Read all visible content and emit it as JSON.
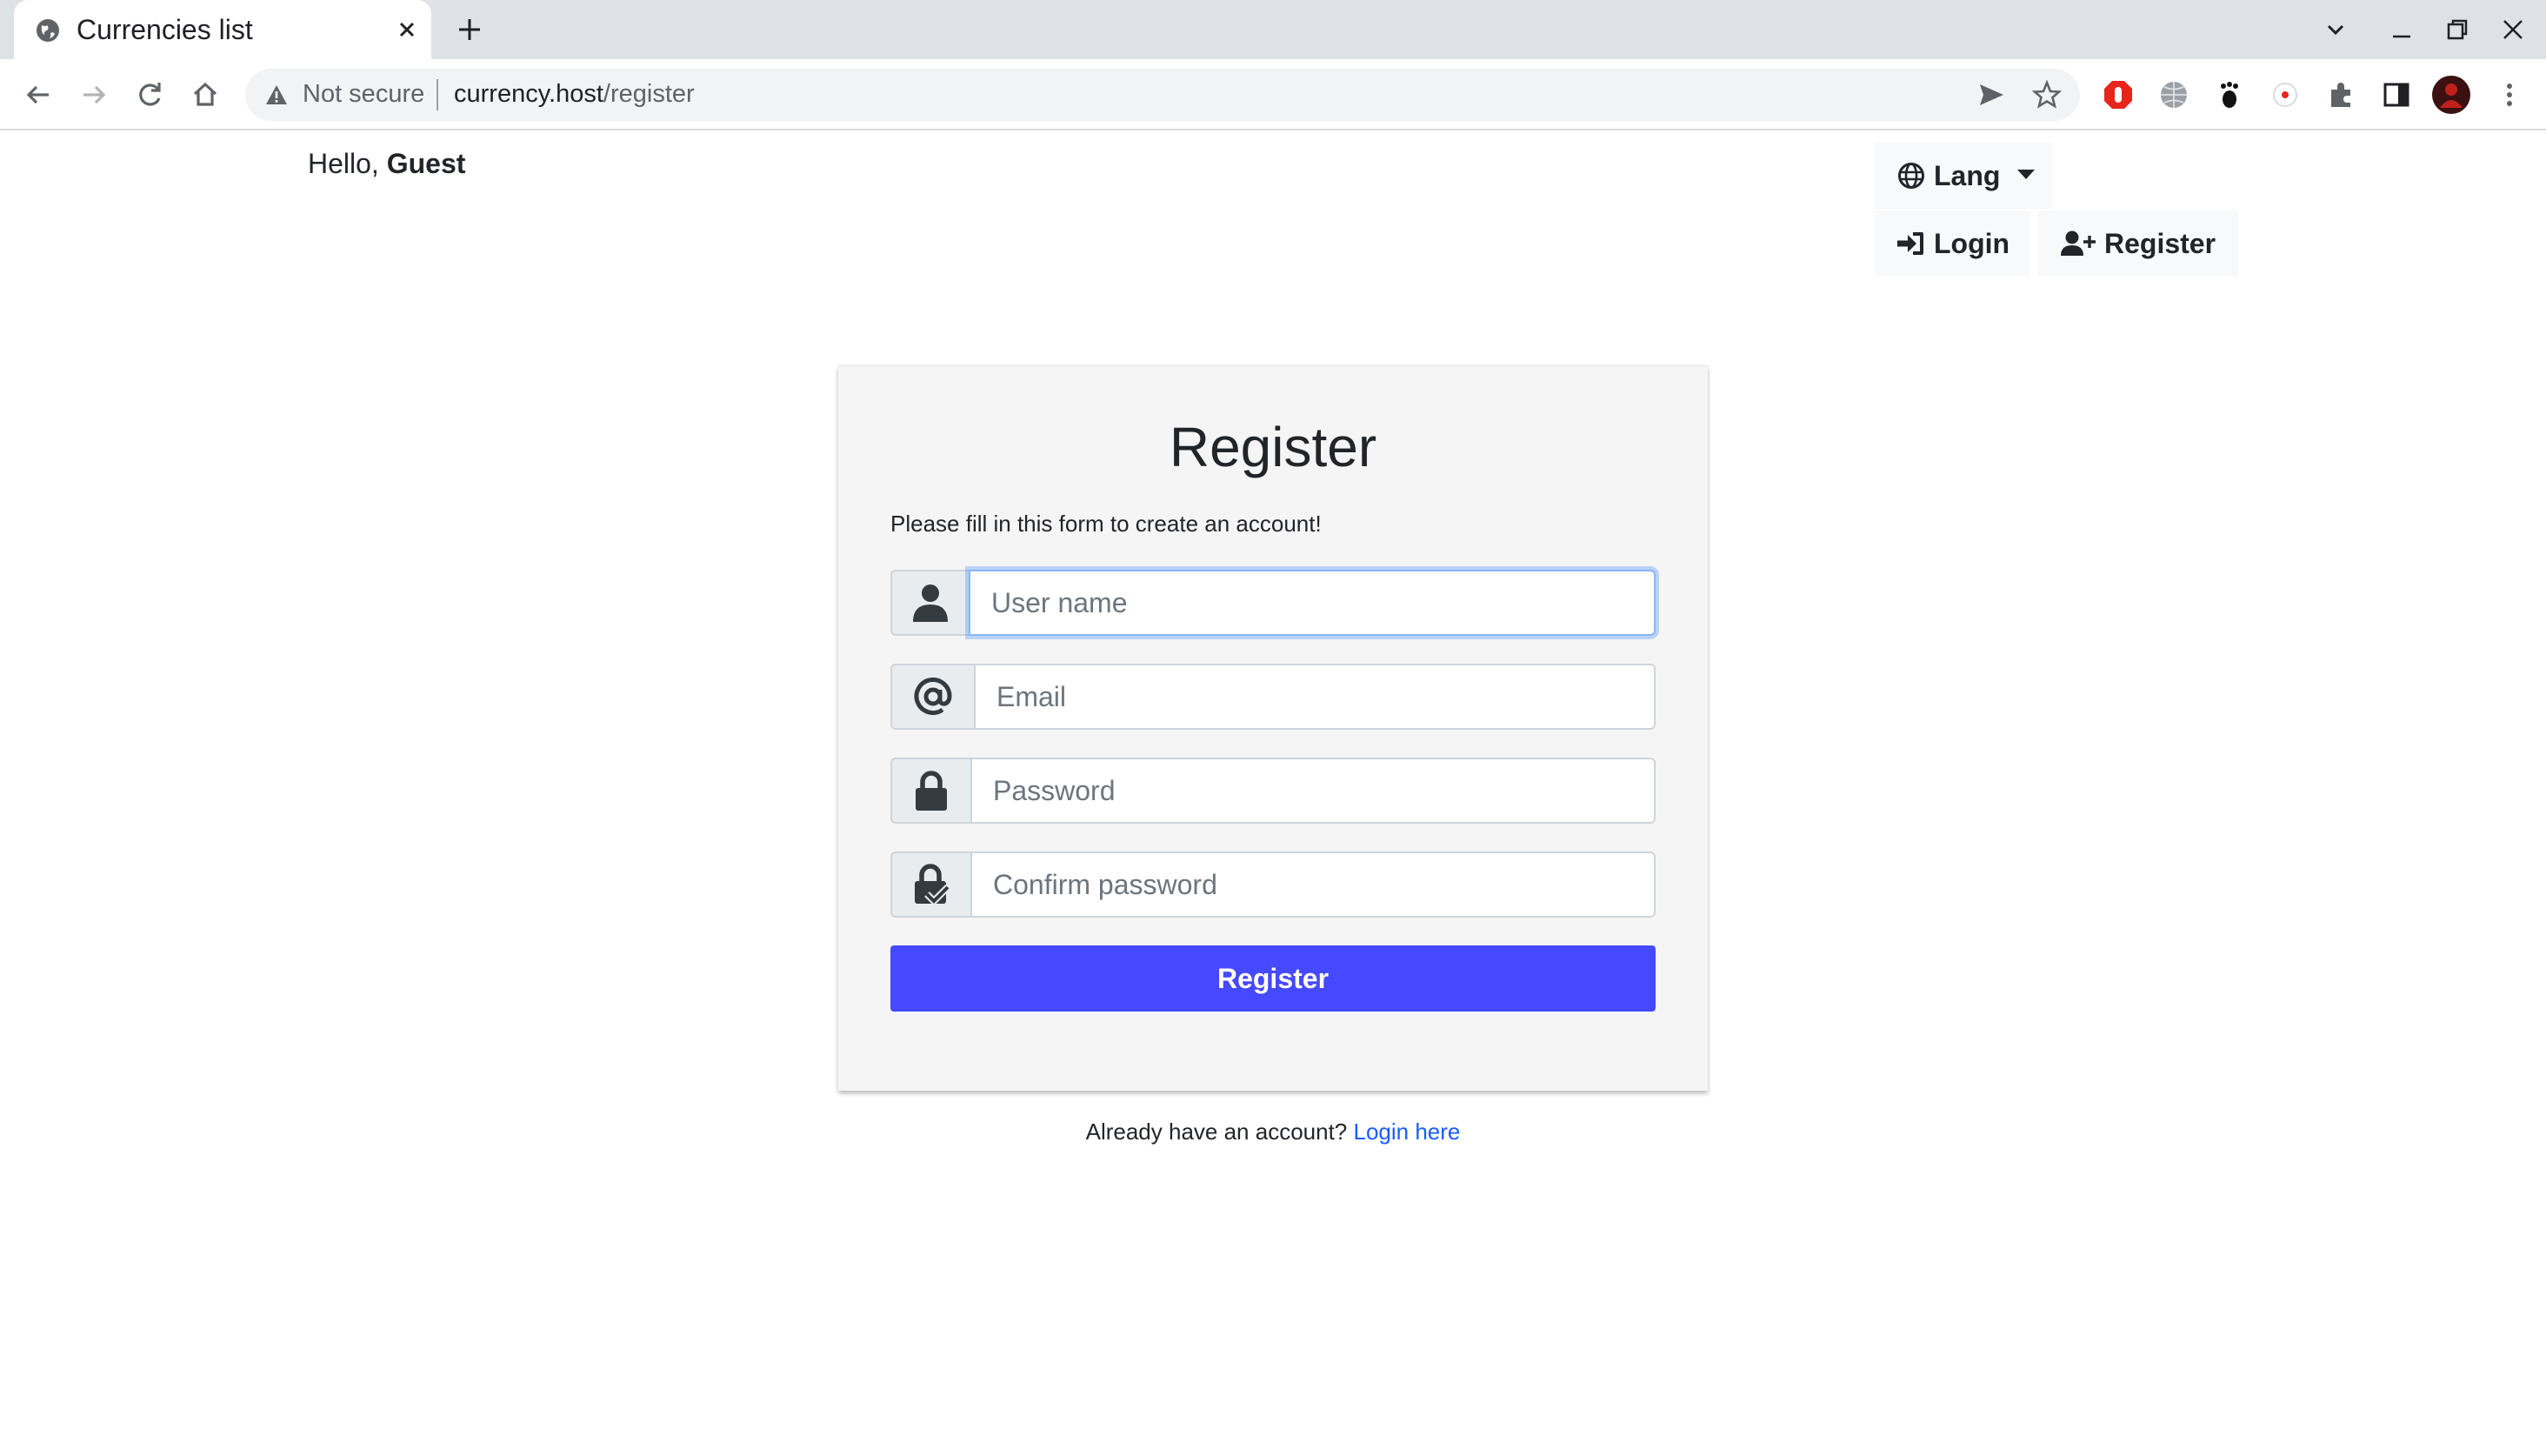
{
  "browser": {
    "tab_title": "Currencies list",
    "security_label": "Not secure",
    "url_host": "currency.host",
    "url_path": "/register"
  },
  "header": {
    "greeting_prefix": "Hello, ",
    "username": "Guest",
    "lang_label": "Lang",
    "login_label": "Login",
    "register_label": "Register"
  },
  "form": {
    "title": "Register",
    "subtitle": "Please fill in this form to create an account!",
    "username_placeholder": "User name",
    "email_placeholder": "Email",
    "password_placeholder": "Password",
    "confirm_placeholder": "Confirm password",
    "submit_label": "Register"
  },
  "footer": {
    "prompt": "Already have an account?",
    "link_label": "Login here"
  },
  "colors": {
    "primary_button": "#4549ff",
    "link": "#1a5cff"
  }
}
